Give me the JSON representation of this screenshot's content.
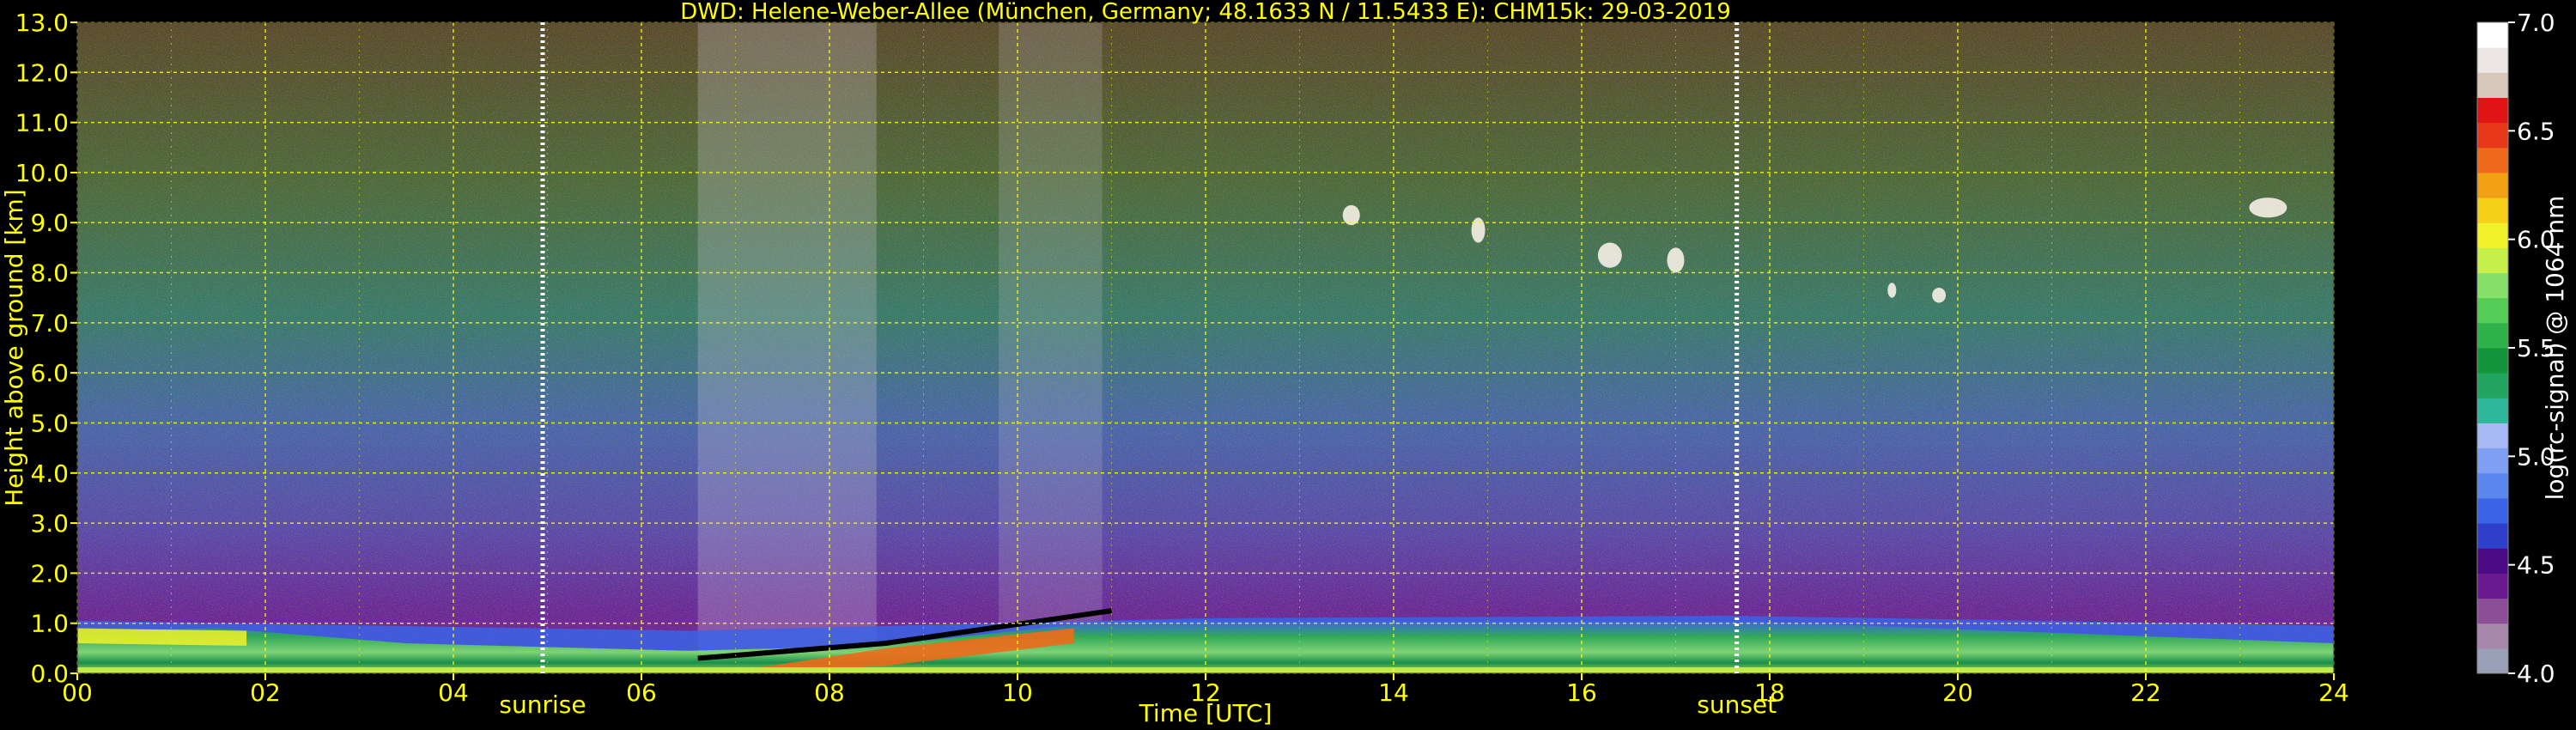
{
  "chart_data": {
    "type": "heatmap",
    "title": "DWD: Helene-Weber-Allee (München, Germany; 48.1633 N / 11.5433 E):    CHM15k: 29-03-2019",
    "xlabel": "Time [UTC]",
    "ylabel": "Height above ground [km]",
    "xlim": [
      0,
      24
    ],
    "ylim": [
      0.0,
      13.0
    ],
    "x_ticks": [
      "00",
      "02",
      "04",
      "06",
      "08",
      "10",
      "12",
      "14",
      "16",
      "18",
      "20",
      "22",
      "24"
    ],
    "y_ticks": [
      "0.0",
      "1.0",
      "2.0",
      "3.0",
      "4.0",
      "5.0",
      "6.0",
      "7.0",
      "8.0",
      "9.0",
      "10.0",
      "11.0",
      "12.0",
      "13.0"
    ],
    "grid": true,
    "annotations": [
      {
        "text": "sunrise",
        "x": 4.95
      },
      {
        "text": "sunset",
        "x": 17.65
      }
    ],
    "colorbar": {
      "label": "log(rc-signal) @ 1064 nm",
      "range": [
        4.0,
        7.0
      ],
      "ticks": [
        "4.0",
        "4.5",
        "5.0",
        "5.5",
        "6.0",
        "6.5",
        "7.0"
      ],
      "colors": [
        "#9aa0b8",
        "#a887ad",
        "#8a4f97",
        "#6a1a8f",
        "#4d0a86",
        "#2e3fc9",
        "#3a64e6",
        "#5b86ee",
        "#7f9ff2",
        "#a6b9f4",
        "#2fb79b",
        "#20a45f",
        "#14943a",
        "#2fb24a",
        "#55cc55",
        "#86e06a",
        "#c6ef4a",
        "#f2f22a",
        "#f6cf1a",
        "#f2a014",
        "#ee6a1a",
        "#e83a1a",
        "#e01414",
        "#d8c8bc",
        "#ece6e4",
        "#ffffff"
      ]
    }
  }
}
